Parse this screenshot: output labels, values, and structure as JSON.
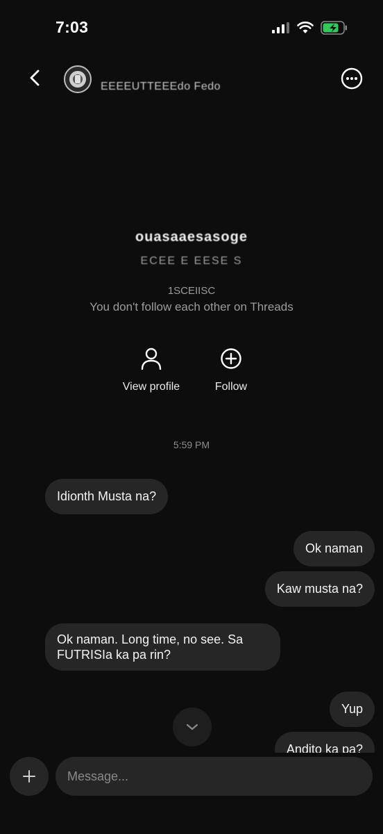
{
  "status_bar": {
    "time": "7:03"
  },
  "header": {
    "name": "EEEEUTTEEEdo Fedo"
  },
  "profile": {
    "name": "ouasaaesasoge",
    "subtitle": "ECEE E EESE S",
    "followers": "1SCEIISC",
    "note": "You don't follow each other on Threads"
  },
  "actions": {
    "view_profile": "View profile",
    "follow": "Follow"
  },
  "thread": {
    "timestamp": "5:59 PM",
    "messages": [
      {
        "from": "them",
        "text": "Idionth Musta na?"
      },
      {
        "from": "me",
        "text": "Ok naman"
      },
      {
        "from": "me",
        "text": "Kaw musta na?"
      },
      {
        "from": "them",
        "text": "Ok naman. Long time, no see.  Sa FUTRISIa ka pa rin?"
      },
      {
        "from": "me",
        "text": "Yup"
      },
      {
        "from": "me",
        "text": "Andito ka pa?"
      }
    ]
  },
  "composer": {
    "placeholder": "Message..."
  }
}
